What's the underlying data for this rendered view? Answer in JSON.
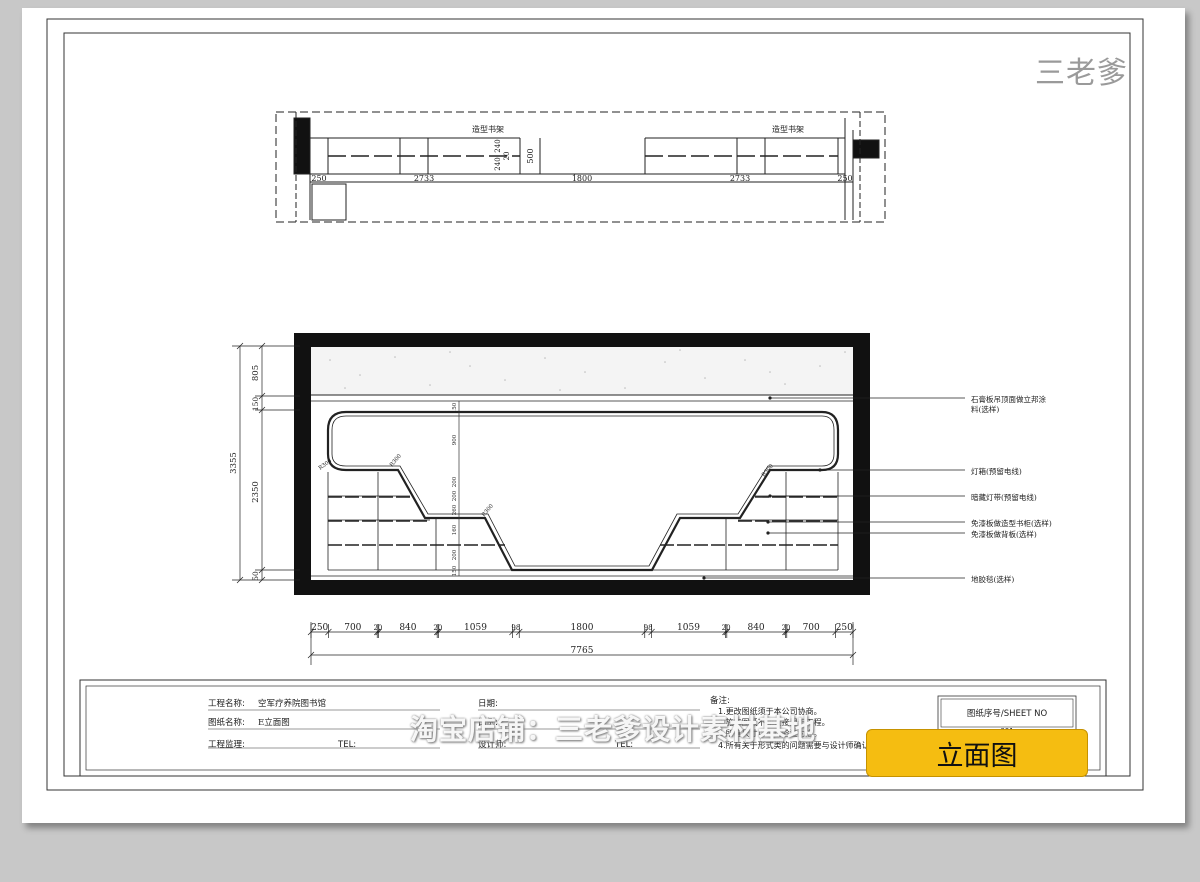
{
  "plan": {
    "shelf_left_label": "造型书架",
    "shelf_right_label": "造型书架",
    "dims": [
      "250",
      "2733",
      "1800",
      "2733",
      "250"
    ],
    "depth_label": "500",
    "small_dims": [
      "240",
      "240",
      "20"
    ]
  },
  "elevation": {
    "height_total": "3355",
    "height_parts": [
      "805",
      "150",
      "2350",
      "50"
    ],
    "bottom_dims": [
      "250",
      "700",
      "20",
      "840",
      "20",
      "1059",
      "98",
      "1800",
      "98",
      "1059",
      "20",
      "840",
      "20",
      "700",
      "250"
    ],
    "total_width": "7765",
    "inner_marks": [
      "150",
      "900",
      "200",
      "200",
      "260",
      "160",
      "200",
      "150"
    ],
    "angle_marks": [
      "R300",
      "R300",
      "R300",
      "R300"
    ],
    "annotations": [
      "石膏板吊顶面做立邦涂",
      "料(选样)",
      "灯箱(预留电线)",
      "暗藏灯带(预留电线)",
      "免漆板做造型书柜(选样)",
      "免漆板做背板(选样)",
      "地胶毯(选样)"
    ]
  },
  "title_block": {
    "project_name_label": "工程名称:",
    "project_name_value": "空军疗养院图书馆",
    "drawing_name_label": "图纸名称:",
    "drawing_name_value": "E立面图",
    "supervisor_label": "工程监理:",
    "tel_label_1": "TEL:",
    "date_label": "日期:",
    "scale_label": "比例:",
    "designer_label": "设计师:",
    "tel_label_2": "TEL:",
    "notes_label": "备注:",
    "notes": [
      "1.更改图纸须于本公司协商。",
      "2.施工图纸不能直接用于工程。",
      "3.所有尺寸以现场验证为准。",
      "4.所有关于形式类的问题需要与设计师确认。"
    ],
    "sheet_no_label": "图纸序号/SHEET NO",
    "sheet_no_value": "001"
  },
  "watermark_top": "三老爹",
  "watermark_mid": "淘宝店铺：三老爹设计素材基地",
  "badge_label": "立面图",
  "colors": {
    "badge": "#f5bd11",
    "line": "#222222",
    "background": "#c8c8c8"
  }
}
